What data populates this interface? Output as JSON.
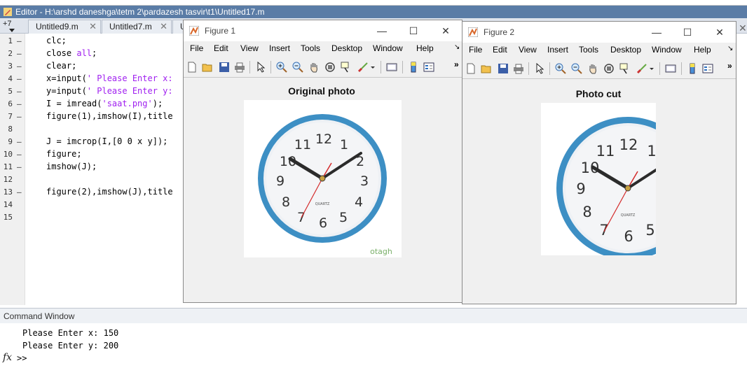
{
  "editor": {
    "title": "Editor - H:\\arshd daneshga\\tetm 2\\pardazesh tasvir\\t1\\Untitled17.m",
    "tab_more": "+7",
    "tabs": [
      "Untitled9.m",
      "Untitled7.m",
      "U"
    ],
    "line_numbers": [
      "1",
      "2",
      "3",
      "4",
      "5",
      "6",
      "7",
      "8",
      "9",
      "10",
      "11",
      "12",
      "13",
      "14",
      "15"
    ],
    "close_glyph": "✕"
  },
  "code": {
    "l1": "clc;",
    "l2a": "close ",
    "l2b": "all",
    "l2c": ";",
    "l3": "clear;",
    "l4a": "x=input(",
    "l4b": "' Please Enter x:",
    "l5a": "y=input(",
    "l5b": "' Please Enter y:",
    "l6a": "I = imread(",
    "l6b": "'saat.png'",
    "l6c": ");",
    "l7": "figure(1),imshow(I),title",
    "l9": "J = imcrop(I,[0 0 x y]);",
    "l10": "figure;",
    "l11": "imshow(J);",
    "l13": "figure(2),imshow(J),title"
  },
  "command_window": {
    "header": "Command Window",
    "lines": [
      "Please Enter x: 150",
      "Please Enter y: 200"
    ],
    "fx": "fx",
    "prompt": ">>"
  },
  "figure1": {
    "title": "Figure 1",
    "menu": [
      "File",
      "Edit",
      "View",
      "Insert",
      "Tools",
      "Desktop",
      "Window",
      "Help"
    ],
    "axes_title": "Original photo",
    "watermark": "otagh"
  },
  "figure2": {
    "title": "Figure 2",
    "menu": [
      "File",
      "Edit",
      "View",
      "Insert",
      "Tools",
      "Desktop",
      "Window",
      "Help"
    ],
    "axes_title": "Photo cut"
  },
  "clock": {
    "numbers": [
      "12",
      "1",
      "2",
      "3",
      "4",
      "5",
      "6",
      "7",
      "8",
      "9",
      "10",
      "11"
    ],
    "brand": "QUARTZ",
    "rim_color": "#3d8fc4",
    "hand_color": "#2b2b2b",
    "second_hand_color": "#d42a2a"
  },
  "window_buttons": {
    "minimize": "—",
    "maximize": "☐",
    "close": "✕"
  }
}
